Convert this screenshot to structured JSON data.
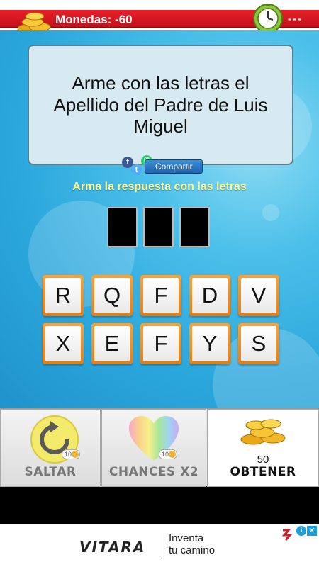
{
  "topbar": {
    "coins_label": "Monedas: -60",
    "dashes": "---"
  },
  "question": {
    "text": "Arme con las letras el Apellido del Padre de Luis Miguel"
  },
  "share": {
    "label": "Compartir",
    "fb": "f",
    "wa": "✆",
    "tw": "t"
  },
  "prompt": "Arma la respuesta con las letras",
  "answer_slots": 3,
  "letters": [
    "R",
    "Q",
    "F",
    "D",
    "V",
    "X",
    "E",
    "F",
    "Y",
    "S"
  ],
  "actions": {
    "saltar": {
      "label": "SALTAR",
      "cost": "10"
    },
    "chances": {
      "label": "CHANCES X2",
      "cost": "10"
    },
    "obtener": {
      "label": "OBTENER",
      "count": "50"
    }
  },
  "ad": {
    "brand": "VITARA",
    "tagline1": "Inventa",
    "tagline2": "tu camino",
    "choice": "i",
    "close": "✕"
  },
  "colors": {
    "topbar_red": "#d4141c",
    "game_blue": "#2ba7dc",
    "tile_orange": "#ef8f22",
    "prompt_yellow": "#fff58a"
  }
}
